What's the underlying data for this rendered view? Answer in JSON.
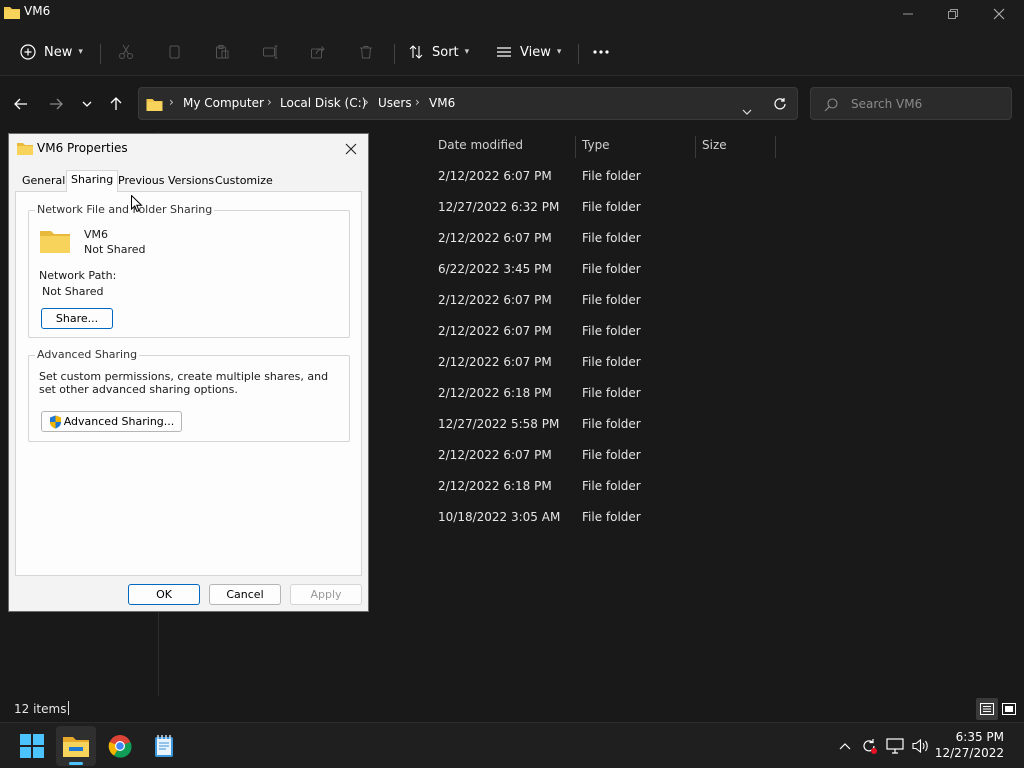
{
  "window": {
    "title": "VM6"
  },
  "toolbar": {
    "new_label": "New",
    "sort_label": "Sort",
    "view_label": "View"
  },
  "address": {
    "crumbs": [
      "My Computer",
      "Local Disk (C:)",
      "Users",
      "VM6"
    ],
    "search_placeholder": "Search VM6"
  },
  "columns": {
    "date": "Date modified",
    "type": "Type",
    "size": "Size"
  },
  "rows": [
    {
      "date": "2/12/2022 6:07 PM",
      "type": "File folder"
    },
    {
      "date": "12/27/2022 6:32 PM",
      "type": "File folder"
    },
    {
      "date": "2/12/2022 6:07 PM",
      "type": "File folder"
    },
    {
      "date": "6/22/2022 3:45 PM",
      "type": "File folder"
    },
    {
      "date": "2/12/2022 6:07 PM",
      "type": "File folder"
    },
    {
      "date": "2/12/2022 6:07 PM",
      "type": "File folder"
    },
    {
      "date": "2/12/2022 6:07 PM",
      "type": "File folder"
    },
    {
      "date": "2/12/2022 6:18 PM",
      "type": "File folder"
    },
    {
      "date": "12/27/2022 5:58 PM",
      "type": "File folder"
    },
    {
      "date": "2/12/2022 6:07 PM",
      "type": "File folder"
    },
    {
      "date": "2/12/2022 6:18 PM",
      "type": "File folder"
    },
    {
      "date": "10/18/2022 3:05 AM",
      "type": "File folder"
    }
  ],
  "status": {
    "item_count": "12 items"
  },
  "dialog": {
    "title": "VM6 Properties",
    "tabs": [
      "General",
      "Sharing",
      "Previous Versions",
      "Customize"
    ],
    "active_tab": "Sharing",
    "network_group": {
      "label": "Network File and Folder Sharing",
      "folder_name": "VM6",
      "share_state": "Not Shared",
      "path_label": "Network Path:",
      "path_value": "Not Shared",
      "share_button": "Share..."
    },
    "advanced_group": {
      "label": "Advanced Sharing",
      "description": "Set custom permissions, create multiple shares, and set other advanced sharing options.",
      "button": "Advanced Sharing..."
    },
    "buttons": {
      "ok": "OK",
      "cancel": "Cancel",
      "apply": "Apply"
    }
  },
  "taskbar": {
    "time": "6:35 PM",
    "date": "12/27/2022",
    "apps": [
      "start-icon",
      "file-explorer-icon",
      "chrome-icon",
      "notepad-icon"
    ]
  },
  "colors": {
    "background": "#191919",
    "folder": "#f2c64b",
    "accent": "#0067c0"
  }
}
